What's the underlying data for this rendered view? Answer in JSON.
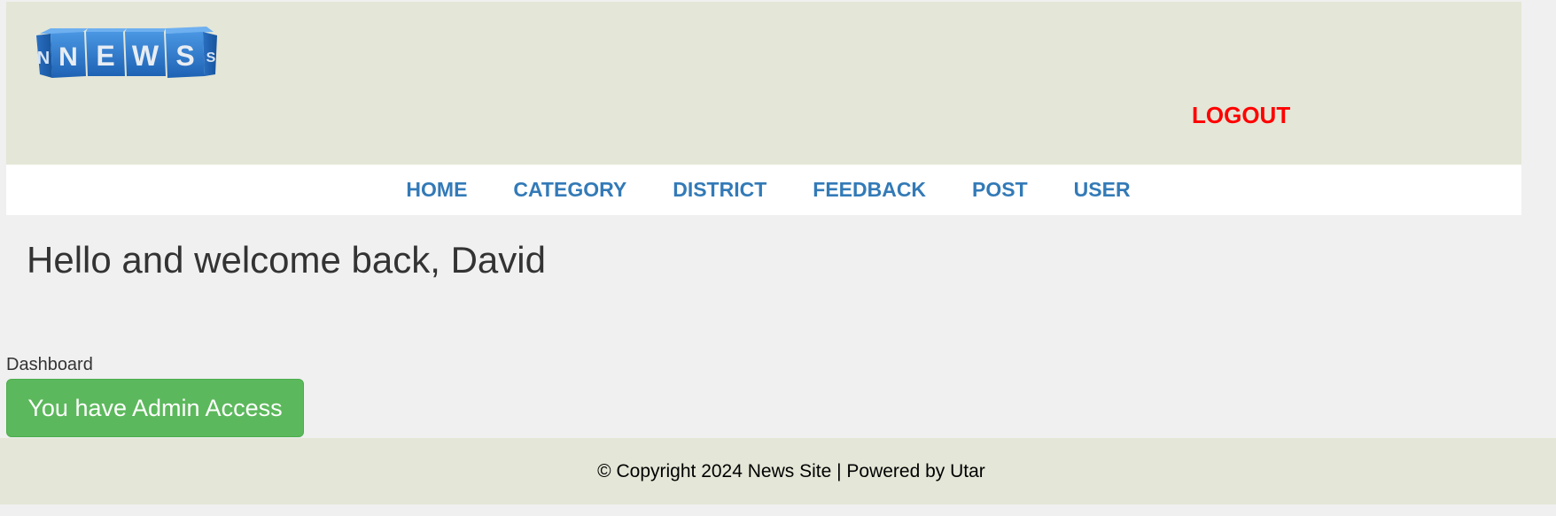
{
  "header": {
    "logo_letters": [
      "N",
      "E",
      "W",
      "S"
    ],
    "logout_label": "LOGOUT"
  },
  "nav": {
    "items": [
      {
        "label": "HOME"
      },
      {
        "label": "CATEGORY"
      },
      {
        "label": "DISTRICT"
      },
      {
        "label": "FEEDBACK"
      },
      {
        "label": "POST"
      },
      {
        "label": "USER"
      }
    ]
  },
  "main": {
    "welcome_heading": "Hello and welcome back, David",
    "dashboard_label": "Dashboard",
    "admin_button_label": "You have Admin Access"
  },
  "footer": {
    "copyright": "© Copyright 2024 News Site | Powered by Utar"
  },
  "colors": {
    "header_bg": "#e4e6d7",
    "nav_link": "#337ab7",
    "logout": "#ff0000",
    "admin_button": "#5cb85c",
    "logo_cube": "#2f7bd1"
  }
}
